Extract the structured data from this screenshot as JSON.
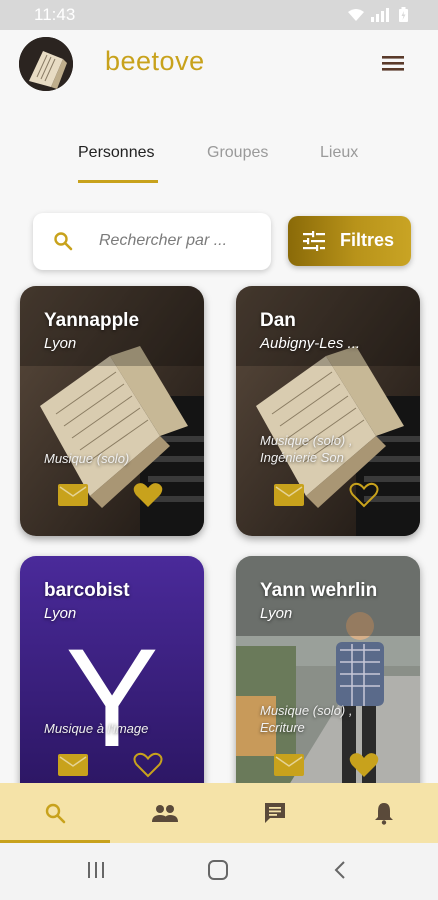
{
  "status_bar": {
    "time": "11:43"
  },
  "header": {
    "title": "beetove"
  },
  "tabs": [
    {
      "label": "Personnes",
      "active": true
    },
    {
      "label": "Groupes",
      "active": false
    },
    {
      "label": "Lieux",
      "active": false
    }
  ],
  "search": {
    "placeholder": "Rechercher par ..."
  },
  "filter": {
    "label": "Filtres"
  },
  "cards": [
    {
      "name": "Yannapple",
      "city": "Lyon",
      "genre": "Musique (solo)",
      "favorited": true
    },
    {
      "name": "Dan",
      "city": "Aubigny-Les ...",
      "genre": "Musique (solo) , Ingénierie Son",
      "favorited": false
    },
    {
      "name": "barcobist",
      "city": "Lyon",
      "genre": "Musique à l'image",
      "favorited": false,
      "avatar_letter": "Y"
    },
    {
      "name": "Yann wehrlin",
      "city": "Lyon",
      "genre": "Musique (solo) , Ecriture",
      "favorited": true
    }
  ],
  "bottom_nav": [
    {
      "icon": "search-icon",
      "active": true
    },
    {
      "icon": "people-icon",
      "active": false
    },
    {
      "icon": "chat-icon",
      "active": false
    },
    {
      "icon": "bell-icon",
      "active": false
    }
  ],
  "colors": {
    "accent": "#c8a21c",
    "nav_background": "#f5e3a8",
    "icon_dark": "#5a4a3a"
  }
}
